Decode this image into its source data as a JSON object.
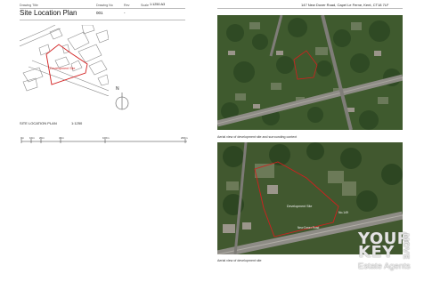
{
  "header": {
    "drawing_title_label": "Drawing Title",
    "drawing_title": "Site Location Plan",
    "drawing_no_label": "Drawing No",
    "drawing_no": "001",
    "rev_label": "Rev",
    "rev": "-",
    "scale_label": "Scale",
    "scale": "1:1250 A3",
    "address": "147 New Dover Road, Capel Le Ferne, Kent, CT18 7LF"
  },
  "plan": {
    "development_site_label": "Development Site",
    "north_label": "N",
    "caption": "SITE LOCATION PLAN",
    "caption_scale": "1:1250",
    "scale_ticks": [
      "0m",
      "10m",
      "20m",
      "40m",
      "100m",
      "200m"
    ]
  },
  "aerial_top": {
    "caption": "Aerial view of development site and surrounding context"
  },
  "aerial_bottom": {
    "development_site_label": "Development Site",
    "house_number_label": "No.149",
    "road_label": "New Dover Road",
    "caption": "Aerial view of development site"
  },
  "logo": {
    "line1": "YOUR",
    "line2": "KEY",
    "word_move": "MOVE",
    "line3": "Estate Agents"
  },
  "colors": {
    "site_boundary": "#d21f1f",
    "map_line": "#8a8a8a"
  }
}
